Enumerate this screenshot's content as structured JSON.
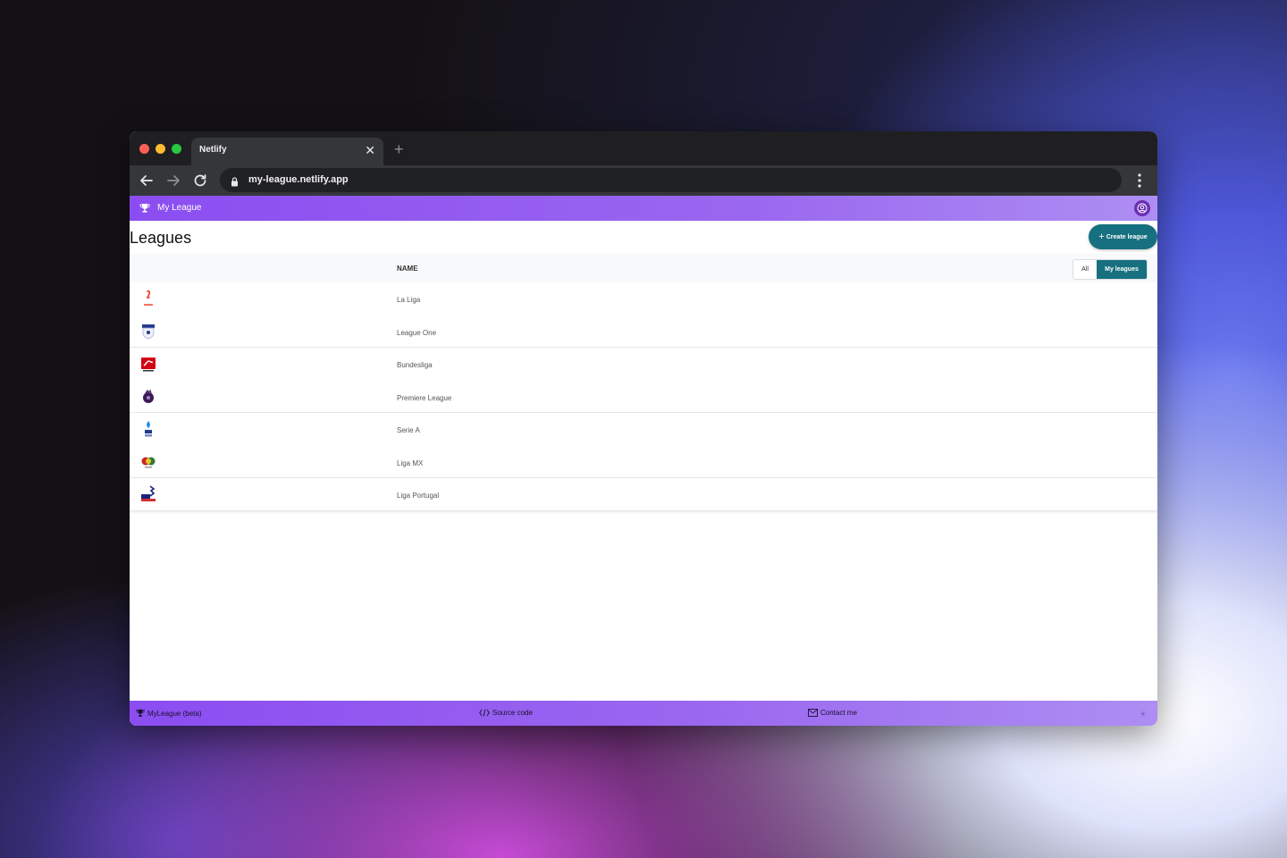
{
  "browser": {
    "tab_title": "Netlify",
    "tab_close": "✕",
    "new_tab": "+",
    "url": "my-league.netlify.app"
  },
  "app": {
    "brand": "My League",
    "page_title": "Leagues",
    "create_button": "Create league",
    "create_icon": "+"
  },
  "table": {
    "column_name": "NAME",
    "filter": {
      "all": "All",
      "mine": "My leagues",
      "selected": "My leagues"
    },
    "rows": [
      {
        "name": "La Liga",
        "icon": "laliga-logo-icon"
      },
      {
        "name": "League One",
        "icon": "league-one-logo-icon"
      },
      {
        "name": "Bundesliga",
        "icon": "bundesliga-logo-icon"
      },
      {
        "name": "Premiere League",
        "icon": "premier-league-logo-icon"
      },
      {
        "name": "Serie A",
        "icon": "serie-a-logo-icon"
      },
      {
        "name": "Liga MX",
        "icon": "liga-mx-logo-icon"
      },
      {
        "name": "Liga Portugal",
        "icon": "liga-portugal-logo-icon"
      }
    ]
  },
  "footer": {
    "brand": "MyLeague (beta)",
    "source_code": "Source code",
    "contact": "Contact me",
    "theme_icon": "sun-icon"
  },
  "colors": {
    "appbar_purple": "#8b4df1",
    "teal_accent": "#16707f"
  }
}
